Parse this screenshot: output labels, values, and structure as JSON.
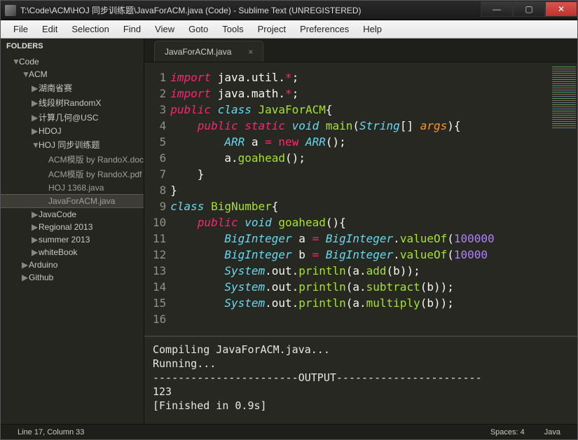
{
  "window": {
    "title": "T:\\Code\\ACM\\HOJ 同步训练题\\JavaForACM.java (Code) - Sublime Text (UNREGISTERED)"
  },
  "win_controls": {
    "min": "—",
    "max": "▢",
    "close": "✕"
  },
  "menu": [
    "File",
    "Edit",
    "Selection",
    "Find",
    "View",
    "Goto",
    "Tools",
    "Project",
    "Preferences",
    "Help"
  ],
  "sidebar": {
    "header": "FOLDERS",
    "items": [
      {
        "label": "Code",
        "caret": "▼",
        "depth": 1
      },
      {
        "label": "ACM",
        "caret": "▼",
        "depth": 2
      },
      {
        "label": "湖南省赛",
        "caret": "▶",
        "depth": 3
      },
      {
        "label": "线段树RandomX",
        "caret": "▶",
        "depth": 3
      },
      {
        "label": "计算几何@USC",
        "caret": "▶",
        "depth": 3
      },
      {
        "label": "HDOJ",
        "caret": "▶",
        "depth": 3
      },
      {
        "label": "HOJ 同步训练题",
        "caret": "▼",
        "depth": 3
      },
      {
        "label": "ACM模版 by RandoX.doc",
        "caret": "",
        "depth": 4
      },
      {
        "label": "ACM模版 by RandoX.pdf",
        "caret": "",
        "depth": 4
      },
      {
        "label": "HOJ 1368.java",
        "caret": "",
        "depth": 4
      },
      {
        "label": "JavaForACM.java",
        "caret": "",
        "depth": 4,
        "selected": true
      },
      {
        "label": "JavaCode",
        "caret": "▶",
        "depth": 3
      },
      {
        "label": "Regional 2013",
        "caret": "▶",
        "depth": 3
      },
      {
        "label": "summer 2013",
        "caret": "▶",
        "depth": 3
      },
      {
        "label": "whiteBook",
        "caret": "▶",
        "depth": 3
      },
      {
        "label": "Arduino",
        "caret": "▶",
        "depth": 2
      },
      {
        "label": "Github",
        "caret": "▶",
        "depth": 2
      }
    ]
  },
  "tab": {
    "label": "JavaForACM.java",
    "close": "×"
  },
  "code": {
    "lines": [
      {
        "n": "1",
        "tokens": [
          [
            "kw",
            "import"
          ],
          [
            "pun",
            " java"
          ],
          [
            "pun",
            "."
          ],
          [
            "id",
            "util"
          ],
          [
            "pun",
            "."
          ],
          [
            "op",
            "*"
          ],
          [
            "pun",
            ";"
          ]
        ]
      },
      {
        "n": "2",
        "tokens": [
          [
            "kw",
            "import"
          ],
          [
            "pun",
            " java"
          ],
          [
            "pun",
            "."
          ],
          [
            "id",
            "math"
          ],
          [
            "pun",
            "."
          ],
          [
            "op",
            "*"
          ],
          [
            "pun",
            ";"
          ]
        ]
      },
      {
        "n": "3",
        "tokens": [
          [
            "kw",
            "public"
          ],
          [
            "pun",
            " "
          ],
          [
            "st",
            "class"
          ],
          [
            "pun",
            " "
          ],
          [
            "cls",
            "JavaForACM"
          ],
          [
            "pun",
            "{"
          ]
        ]
      },
      {
        "n": "4",
        "tokens": [
          [
            "pun",
            "    "
          ],
          [
            "kw",
            "public"
          ],
          [
            "pun",
            " "
          ],
          [
            "kw",
            "static"
          ],
          [
            "pun",
            " "
          ],
          [
            "st",
            "void"
          ],
          [
            "pun",
            " "
          ],
          [
            "cls",
            "main"
          ],
          [
            "pun",
            "("
          ],
          [
            "st",
            "String"
          ],
          [
            "pun",
            "[] "
          ],
          [
            "par",
            "args"
          ],
          [
            "pun",
            "){"
          ]
        ]
      },
      {
        "n": "5",
        "tokens": [
          [
            "pun",
            "        "
          ],
          [
            "st",
            "ARR"
          ],
          [
            "pun",
            " a "
          ],
          [
            "op",
            "="
          ],
          [
            "pun",
            " "
          ],
          [
            "op",
            "new"
          ],
          [
            "pun",
            " "
          ],
          [
            "st",
            "ARR"
          ],
          [
            "pun",
            "();"
          ]
        ]
      },
      {
        "n": "6",
        "tokens": [
          [
            "pun",
            "        a"
          ],
          [
            "pun",
            "."
          ],
          [
            "fn",
            "goahead"
          ],
          [
            "pun",
            "();"
          ]
        ]
      },
      {
        "n": "7",
        "tokens": [
          [
            "pun",
            "    }"
          ]
        ]
      },
      {
        "n": "8",
        "tokens": [
          [
            "pun",
            "}"
          ]
        ]
      },
      {
        "n": "9",
        "tokens": [
          [
            "pun",
            ""
          ]
        ]
      },
      {
        "n": "10",
        "tokens": [
          [
            "st",
            "class"
          ],
          [
            "pun",
            " "
          ],
          [
            "cls",
            "BigNumber"
          ],
          [
            "pun",
            "{"
          ]
        ]
      },
      {
        "n": "11",
        "tokens": [
          [
            "pun",
            "    "
          ],
          [
            "kw",
            "public"
          ],
          [
            "pun",
            " "
          ],
          [
            "st",
            "void"
          ],
          [
            "pun",
            " "
          ],
          [
            "cls",
            "goahead"
          ],
          [
            "pun",
            "(){"
          ]
        ]
      },
      {
        "n": "12",
        "tokens": [
          [
            "pun",
            "        "
          ],
          [
            "st",
            "BigInteger"
          ],
          [
            "pun",
            " a "
          ],
          [
            "op",
            "="
          ],
          [
            "pun",
            " "
          ],
          [
            "st",
            "BigInteger"
          ],
          [
            "pun",
            "."
          ],
          [
            "fn",
            "valueOf"
          ],
          [
            "pun",
            "("
          ],
          [
            "num",
            "100000"
          ]
        ]
      },
      {
        "n": "13",
        "tokens": [
          [
            "pun",
            "        "
          ],
          [
            "st",
            "BigInteger"
          ],
          [
            "pun",
            " b "
          ],
          [
            "op",
            "="
          ],
          [
            "pun",
            " "
          ],
          [
            "st",
            "BigInteger"
          ],
          [
            "pun",
            "."
          ],
          [
            "fn",
            "valueOf"
          ],
          [
            "pun",
            "("
          ],
          [
            "num",
            "10000"
          ]
        ]
      },
      {
        "n": "14",
        "tokens": [
          [
            "pun",
            "        "
          ],
          [
            "st",
            "System"
          ],
          [
            "pun",
            ".out."
          ],
          [
            "fn",
            "println"
          ],
          [
            "pun",
            "(a."
          ],
          [
            "fn",
            "add"
          ],
          [
            "pun",
            "(b));"
          ]
        ]
      },
      {
        "n": "15",
        "tokens": [
          [
            "pun",
            "        "
          ],
          [
            "st",
            "System"
          ],
          [
            "pun",
            ".out."
          ],
          [
            "fn",
            "println"
          ],
          [
            "pun",
            "(a."
          ],
          [
            "fn",
            "subtract"
          ],
          [
            "pun",
            "(b));"
          ]
        ]
      },
      {
        "n": "16",
        "tokens": [
          [
            "pun",
            "        "
          ],
          [
            "st",
            "System"
          ],
          [
            "pun",
            ".out."
          ],
          [
            "fn",
            "println"
          ],
          [
            "pun",
            "(a."
          ],
          [
            "fn",
            "multiply"
          ],
          [
            "pun",
            "(b));"
          ]
        ]
      }
    ]
  },
  "console": {
    "lines": [
      "Compiling JavaForACM.java...",
      "Running...",
      "-----------------------OUTPUT-----------------------",
      "123",
      "[Finished in 0.9s]"
    ]
  },
  "status": {
    "pos": "Line 17, Column 33",
    "spaces": "Spaces: 4",
    "lang": "Java"
  }
}
